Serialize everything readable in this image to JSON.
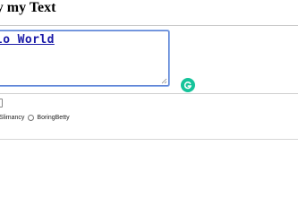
{
  "header": {
    "title": "ify my Text"
  },
  "editor": {
    "value": "lo World"
  },
  "style_options": [
    {
      "label": "cySlimancy"
    },
    {
      "label": "BoringBetty"
    }
  ],
  "icons": {
    "grammarly": "grammarly-icon"
  },
  "colors": {
    "accent": "#15c39a",
    "focus_border": "#5b7fd1",
    "text": "#1a1aa8"
  }
}
